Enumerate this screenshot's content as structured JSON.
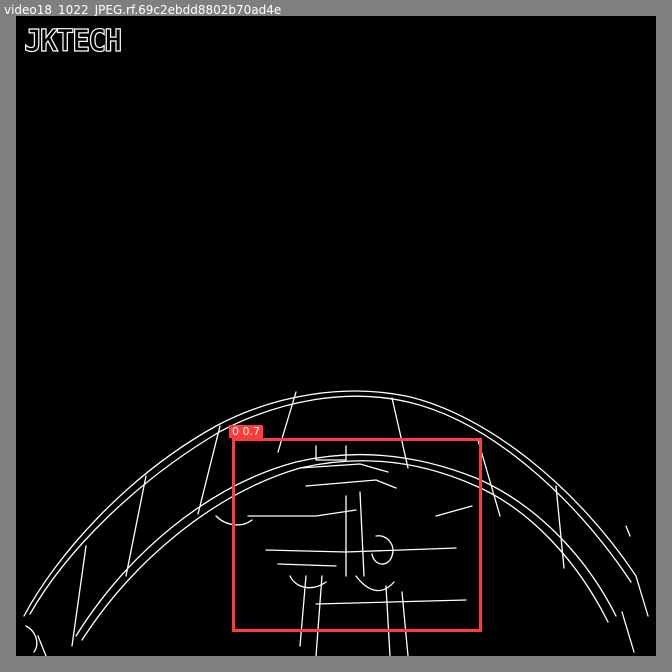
{
  "image_title": "video18_1022_JPEG.rf.69c2ebdd8802b70ad4e",
  "watermark": "JKTECH",
  "detection": {
    "label": "0 0.7",
    "color": "#ff3b3b"
  },
  "colors": {
    "background": "#7f7f7f",
    "image": "#000000",
    "edges": "#ffffff"
  }
}
